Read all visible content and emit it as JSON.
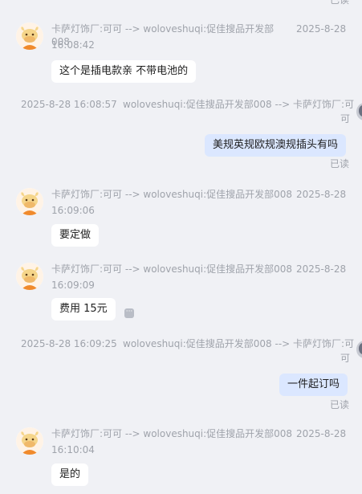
{
  "top_read_fragment": "已读",
  "messages": [
    {
      "direction": "in",
      "header_line1": "卡萨灯饰厂:可可 --> woloveshuqi:促佳搜品开发部008",
      "date": "2025-8-28",
      "time": "16:08:42",
      "text": "这个是插电款亲 不带电池的",
      "avatar_icon": "cow-avatar-icon"
    },
    {
      "direction": "out",
      "timestamp": "2025-8-28 16:08:57",
      "header_line1": "woloveshuqi:促佳搜品开发部008 --> 卡萨灯饰厂:可",
      "header_line2": "可",
      "text": "美规英规欧规澳规插头有吗",
      "status": "已读"
    },
    {
      "direction": "in",
      "header_line1": "卡萨灯饰厂:可可 --> woloveshuqi:促佳搜品开发部008",
      "date": "2025-8-28",
      "time": "16:09:06",
      "text": "要定做",
      "avatar_icon": "cow-avatar-icon"
    },
    {
      "direction": "in",
      "header_line1": "卡萨灯饰厂:可可 --> woloveshuqi:促佳搜品开发部008",
      "date": "2025-8-28",
      "time": "16:09:09",
      "text": "费用 15元",
      "avatar_icon": "cow-avatar-icon",
      "more_icon": "more-options-icon"
    },
    {
      "direction": "out",
      "timestamp": "2025-8-28 16:09:25",
      "header_line1": "woloveshuqi:促佳搜品开发部008 --> 卡萨灯饰厂:可",
      "header_line2": "可",
      "text": "一件起订吗",
      "status": "已读"
    },
    {
      "direction": "in",
      "header_line1": "卡萨灯饰厂:可可 --> woloveshuqi:促佳搜品开发部008",
      "date": "2025-8-28",
      "time": "16:10:04",
      "text": "是的",
      "avatar_icon": "cow-avatar-icon"
    }
  ],
  "colors": {
    "background": "#f0f1f5",
    "incoming_bubble": "#ffffff",
    "outgoing_bubble": "#dbe7ff",
    "meta_text": "#9fa3ab",
    "avatar_orange": "#f08a2c"
  }
}
